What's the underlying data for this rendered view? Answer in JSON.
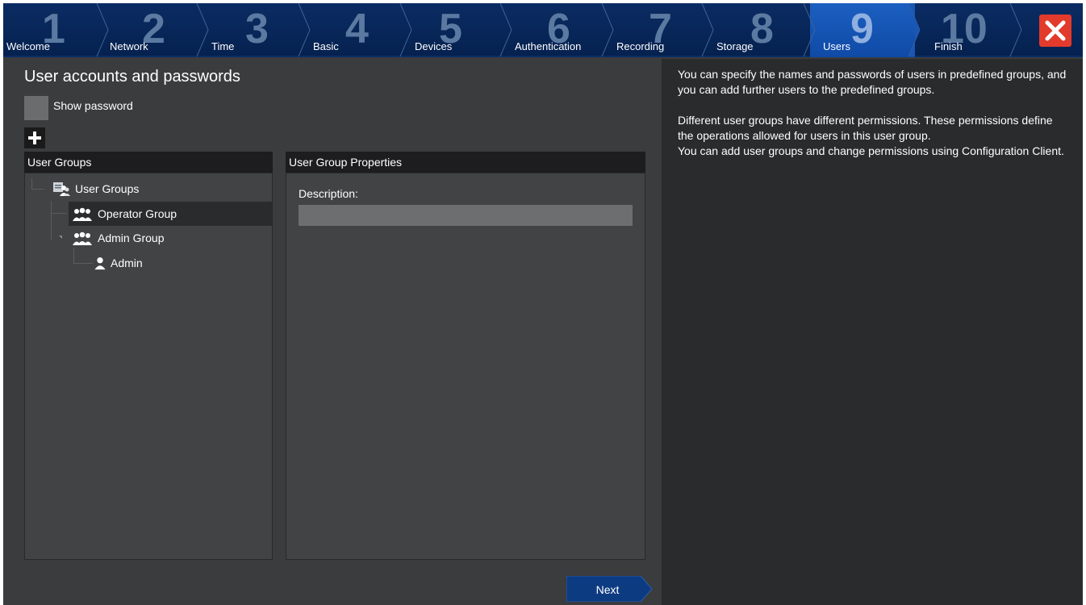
{
  "wizard": {
    "steps": [
      {
        "number": "1",
        "label": "Welcome"
      },
      {
        "number": "2",
        "label": "Network"
      },
      {
        "number": "3",
        "label": "Time"
      },
      {
        "number": "4",
        "label": "Basic"
      },
      {
        "number": "5",
        "label": "Devices"
      },
      {
        "number": "6",
        "label": "Authentication"
      },
      {
        "number": "7",
        "label": "Recording"
      },
      {
        "number": "8",
        "label": "Storage"
      },
      {
        "number": "9",
        "label": "Users"
      },
      {
        "number": "10",
        "label": "Finish"
      }
    ],
    "active_step": "9",
    "close_icon": "close-icon",
    "colors": {
      "bar": "#05214f",
      "active": "#1c5fc0",
      "close": "#e23a2b",
      "background": "#3b3c3e",
      "help_background": "#2a2b2d"
    }
  },
  "main": {
    "title": "User accounts and passwords",
    "show_password_label": "Show password",
    "add_icon": "plus-icon",
    "user_groups_panel": {
      "header": "User Groups",
      "tree": {
        "root": {
          "label": "User Groups",
          "icon": "user-groups-icon"
        },
        "operator": {
          "label": "Operator Group",
          "icon": "group-icon",
          "selected": true
        },
        "admin_group": {
          "label": "Admin Group",
          "icon": "group-icon"
        },
        "admin_user": {
          "label": "Admin",
          "icon": "user-icon"
        }
      }
    },
    "properties_panel": {
      "header": "User Group Properties",
      "description_label": "Description:",
      "description_value": ""
    },
    "next_label": "Next"
  },
  "help": {
    "p1": "You can specify the names and passwords of users in predefined groups, and you can add further users to the predefined groups.",
    "p2": "Different user groups have different permissions. These permissions define the operations allowed for users in this user group.",
    "p3": "You can add user groups and change permissions using Configuration Client."
  }
}
